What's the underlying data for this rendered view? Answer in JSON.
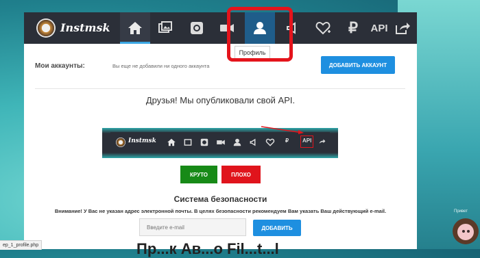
{
  "brand": {
    "name": "Instmsk",
    "logo": "instagram-camera-logo"
  },
  "nav": {
    "items": [
      {
        "icon": "home-icon",
        "active": true
      },
      {
        "icon": "photos-icon"
      },
      {
        "icon": "instagram-icon"
      },
      {
        "icon": "video-icon"
      },
      {
        "icon": "profile-icon",
        "highlighted": true
      },
      {
        "icon": "megaphone-icon"
      },
      {
        "icon": "heart-plus-icon"
      },
      {
        "icon": "ruble-icon",
        "label": "₽"
      },
      {
        "icon": "api-icon",
        "label": "API"
      },
      {
        "icon": "share-icon"
      }
    ],
    "tooltip": "Профиль"
  },
  "accounts": {
    "label": "Мои аккаунты:",
    "empty": "Вы еще не добавили ни одного аккаунта",
    "add_button": "ДОБАВИТЬ АККАУНТ"
  },
  "announcement": "Друзья! Мы опубликовали свой API.",
  "preview": {
    "brand": "Instmsk",
    "api_label": "API"
  },
  "feedback": {
    "good": "КРУТО",
    "bad": "ПЛОХО"
  },
  "security": {
    "title": "Система безопасности",
    "warning": "Внимание! У Вас не указан адрес электронной почты. В целях безопасности рекомендуем Вам указать Ваш действующий e-mail.",
    "email_placeholder": "Введите e-mail",
    "add_button": "ДОБАВИТЬ"
  },
  "partial_heading": "Пр...к Ав...о Fil...t...l",
  "status_bar_url": "ep_1_profile.php",
  "chat_widget": {
    "label": "Привет"
  },
  "colors": {
    "nav_bg": "#2b2f38",
    "accent": "#1e8fe0",
    "green": "#178a17",
    "red": "#e0141c",
    "highlight": "#e4141c"
  }
}
